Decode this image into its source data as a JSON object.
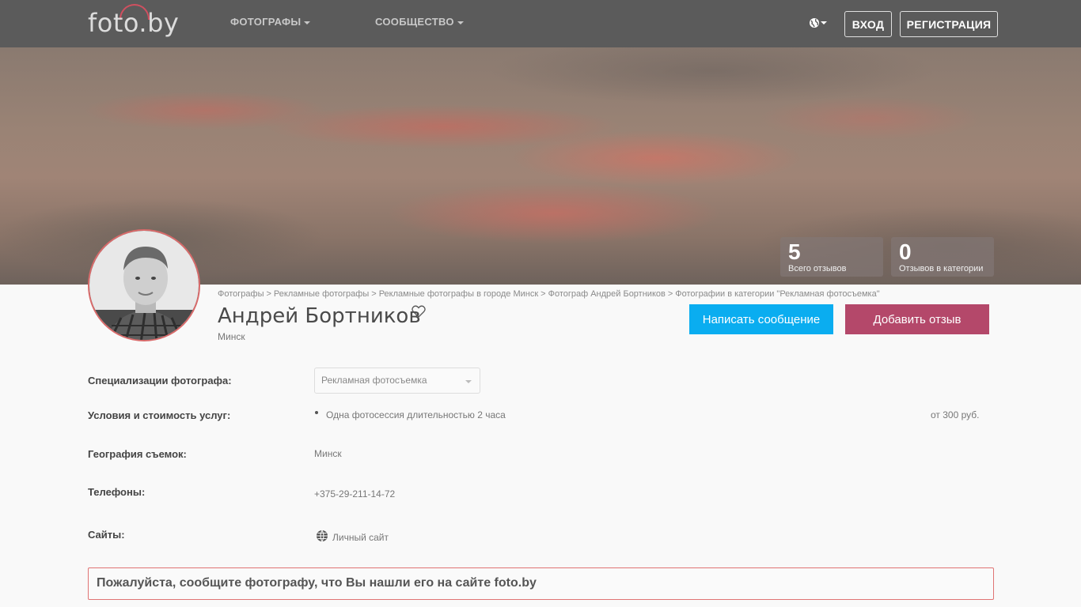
{
  "header": {
    "logo_text": "foto.by",
    "nav": [
      {
        "label": "ФОТОГРАФЫ"
      },
      {
        "label": "СООБЩЕСТВО"
      }
    ],
    "language_icon": "globe-icon",
    "login_label": "ВХОД",
    "register_label": "РЕГИСТРАЦИЯ"
  },
  "stats": [
    {
      "value": "5",
      "label": "Всего отзывов"
    },
    {
      "value": "0",
      "label": "Отзывов в категории"
    }
  ],
  "breadcrumb": [
    "Фотографы",
    "Рекламные фотографы",
    "Рекламные фотографы в городе Минск",
    "Фотограф Андрей Бортников",
    "Фотографии в категории \"Рекламная фотосъемка\""
  ],
  "profile": {
    "name": "Андрей Бортников",
    "city": "Минск",
    "favorite_icon": "heart-icon",
    "message_button": "Написать сообщение",
    "review_button": "Добавить отзыв"
  },
  "details": {
    "specializations_label": "Специализации фотографа:",
    "specializations_value": "Рекламная фотосъемка",
    "services_label": "Условия и стоимость услуг:",
    "service_item": "Одна фотосессия длительностью 2 часа",
    "service_price": "от 300 руб.",
    "geography_label": "География съемок:",
    "geography_value": "Минск",
    "phones_label": "Телефоны:",
    "phones_value": "+375-29-211-14-72",
    "sites_label": "Сайты:",
    "sites_value": "Личный сайт"
  },
  "notice": "Пожалуйста, сообщите фотографу, что Вы нашли его на сайте foto.by",
  "colors": {
    "topbar": "#5b5b5b",
    "message_button": "#0aadf0",
    "review_button": "#b4486a",
    "notice_border": "#e07474"
  }
}
